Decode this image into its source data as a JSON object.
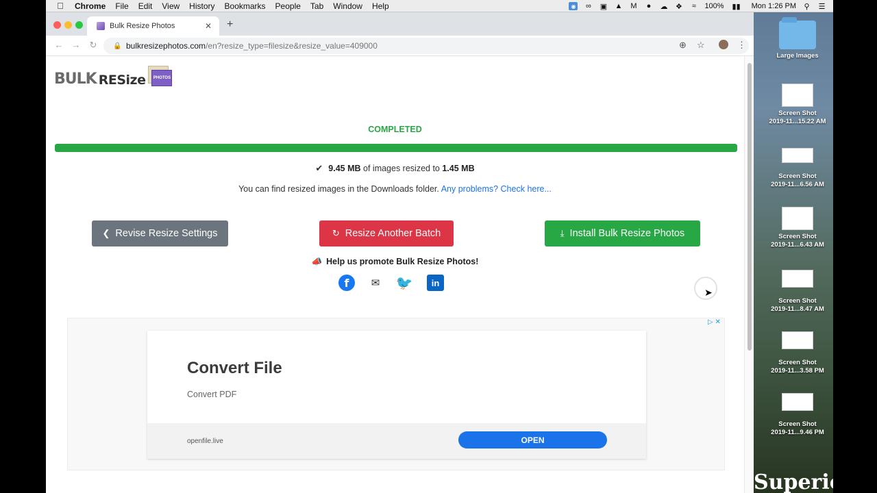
{
  "menubar": {
    "app": "Chrome",
    "items": [
      "File",
      "Edit",
      "View",
      "History",
      "Bookmarks",
      "People",
      "Tab",
      "Window",
      "Help"
    ],
    "battery": "100%",
    "clock": "Mon 1:26 PM"
  },
  "browser": {
    "tab_title": "Bulk Resize Photos",
    "url_host": "bulkresizephotos.com",
    "url_path": "/en?resize_type=filesize&resize_value=409000"
  },
  "page": {
    "logo_bulk": "BULK",
    "logo_resize": "RESize",
    "logo_photos": "PHOTOS",
    "status": "COMPLETED",
    "progress_percent": 100,
    "summary_from": "9.45 MB",
    "summary_middle": "of images resized to",
    "summary_to": "1.45 MB",
    "downloads_text": "You can find resized images in the Downloads folder.",
    "problems_link": "Any problems? Check here...",
    "buttons": {
      "revise": "Revise Resize Settings",
      "another": "Resize Another Batch",
      "install": "Install Bulk Resize Photos"
    },
    "promote_text": "Help us promote Bulk Resize Photos!"
  },
  "ad": {
    "title": "Convert File",
    "subtitle": "Convert PDF",
    "domain": "openfile.live",
    "cta": "OPEN"
  },
  "desktop": {
    "items": [
      {
        "label": "Large Images"
      },
      {
        "label": "Screen Shot",
        "sub": "2019-11...15.22 AM"
      },
      {
        "label": "Screen Shot",
        "sub": "2019-11...6.56 AM"
      },
      {
        "label": "Screen Shot",
        "sub": "2019-11...6.43 AM"
      },
      {
        "label": "Screen Shot",
        "sub": "2019-11...8.47 AM"
      },
      {
        "label": "Screen Shot",
        "sub": "2019-11...3.58 PM"
      },
      {
        "label": "Screen Shot",
        "sub": "2019-11...9.46 PM"
      }
    ],
    "wallpaper_text": "Superior"
  },
  "colors": {
    "success": "#28a745",
    "danger": "#dc3545",
    "secondary": "#6c757d",
    "link": "#1a73e8"
  }
}
